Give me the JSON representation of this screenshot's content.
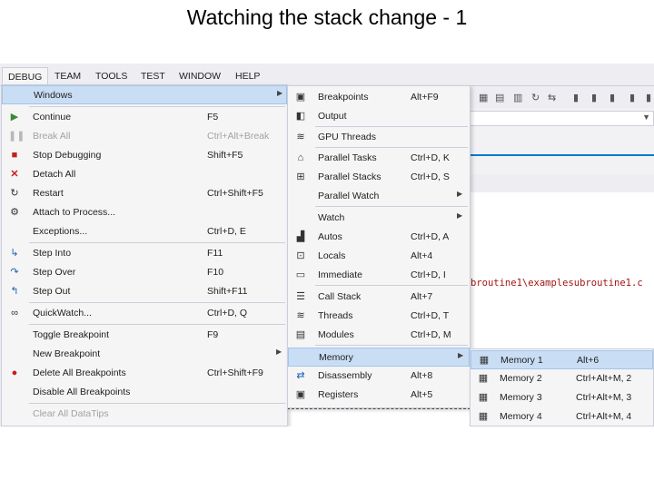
{
  "slide": {
    "title": "Watching the stack change - 1"
  },
  "menubar": {
    "items": [
      "DEBUG",
      "TEAM",
      "TOOLS",
      "TEST",
      "WINDOW",
      "HELP"
    ]
  },
  "editor": {
    "path_text": "broutine1\\examplesubroutine1.c"
  },
  "debug_menu": {
    "items": [
      {
        "label": "Windows",
        "shortcut": "",
        "icon": "none",
        "submenu": true,
        "disabled": false
      },
      {
        "label": "Continue",
        "shortcut": "F5",
        "icon": "play-icon",
        "disabled": false
      },
      {
        "label": "Break All",
        "shortcut": "Ctrl+Alt+Break",
        "icon": "pause-icon",
        "disabled": true
      },
      {
        "label": "Stop Debugging",
        "shortcut": "Shift+F5",
        "icon": "stop-icon",
        "disabled": false
      },
      {
        "label": "Detach All",
        "shortcut": "",
        "icon": "detach-icon",
        "disabled": false
      },
      {
        "label": "Restart",
        "shortcut": "Ctrl+Shift+F5",
        "icon": "restart-icon",
        "disabled": false
      },
      {
        "label": "Attach to Process...",
        "shortcut": "",
        "icon": "attach-icon",
        "disabled": false
      },
      {
        "label": "Exceptions...",
        "shortcut": "Ctrl+D, E",
        "icon": "none",
        "disabled": false
      },
      {
        "label": "Step Into",
        "shortcut": "F11",
        "icon": "step-into-icon",
        "disabled": false
      },
      {
        "label": "Step Over",
        "shortcut": "F10",
        "icon": "step-over-icon",
        "disabled": false
      },
      {
        "label": "Step Out",
        "shortcut": "Shift+F11",
        "icon": "step-out-icon",
        "disabled": false
      },
      {
        "label": "QuickWatch...",
        "shortcut": "Ctrl+D, Q",
        "icon": "glasses-icon",
        "disabled": false
      },
      {
        "label": "Toggle Breakpoint",
        "shortcut": "F9",
        "icon": "none",
        "disabled": false
      },
      {
        "label": "New Breakpoint",
        "shortcut": "",
        "icon": "none",
        "submenu": true,
        "disabled": false
      },
      {
        "label": "Delete All Breakpoints",
        "shortcut": "Ctrl+Shift+F9",
        "icon": "delete-breakpoints-icon",
        "disabled": false
      },
      {
        "label": "Disable All Breakpoints",
        "shortcut": "",
        "icon": "none",
        "disabled": false
      },
      {
        "label": "Clear All DataTips",
        "shortcut": "",
        "icon": "none",
        "disabled": true
      }
    ]
  },
  "windows_menu": {
    "items": [
      {
        "label": "Breakpoints",
        "shortcut": "Alt+F9",
        "icon": "breakpoints-window-icon"
      },
      {
        "label": "Output",
        "shortcut": "",
        "icon": "output-icon"
      },
      {
        "label": "GPU Threads",
        "shortcut": "",
        "icon": "gpu-threads-icon"
      },
      {
        "label": "Parallel Tasks",
        "shortcut": "Ctrl+D, K",
        "icon": "parallel-tasks-icon"
      },
      {
        "label": "Parallel Stacks",
        "shortcut": "Ctrl+D, S",
        "icon": "parallel-stacks-icon"
      },
      {
        "label": "Parallel Watch",
        "shortcut": "",
        "icon": "none",
        "submenu": true
      },
      {
        "label": "Watch",
        "shortcut": "",
        "icon": "none",
        "submenu": true
      },
      {
        "label": "Autos",
        "shortcut": "Ctrl+D, A",
        "icon": "autos-icon"
      },
      {
        "label": "Locals",
        "shortcut": "Alt+4",
        "icon": "locals-icon"
      },
      {
        "label": "Immediate",
        "shortcut": "Ctrl+D, I",
        "icon": "immediate-icon"
      },
      {
        "label": "Call Stack",
        "shortcut": "Alt+7",
        "icon": "call-stack-icon"
      },
      {
        "label": "Threads",
        "shortcut": "Ctrl+D, T",
        "icon": "threads-icon"
      },
      {
        "label": "Modules",
        "shortcut": "Ctrl+D, M",
        "icon": "modules-icon"
      },
      {
        "label": "Memory",
        "shortcut": "",
        "icon": "none",
        "submenu": true
      },
      {
        "label": "Disassembly",
        "shortcut": "Alt+8",
        "icon": "disassembly-icon"
      },
      {
        "label": "Registers",
        "shortcut": "Alt+5",
        "icon": "registers-icon"
      }
    ]
  },
  "memory_menu": {
    "items": [
      {
        "label": "Memory 1",
        "shortcut": "Alt+6",
        "icon": "memory-chip-icon"
      },
      {
        "label": "Memory 2",
        "shortcut": "Ctrl+Alt+M, 2",
        "icon": "memory-chip-icon"
      },
      {
        "label": "Memory 3",
        "shortcut": "Ctrl+Alt+M, 3",
        "icon": "memory-chip-icon"
      },
      {
        "label": "Memory 4",
        "shortcut": "Ctrl+Alt+M, 4",
        "icon": "memory-chip-icon"
      }
    ]
  },
  "colors": {
    "menu_bg": "#f5f5f5",
    "highlight": "#c9def5",
    "accent_blue": "#007acc",
    "disabled_text": "#a2a2a2"
  }
}
